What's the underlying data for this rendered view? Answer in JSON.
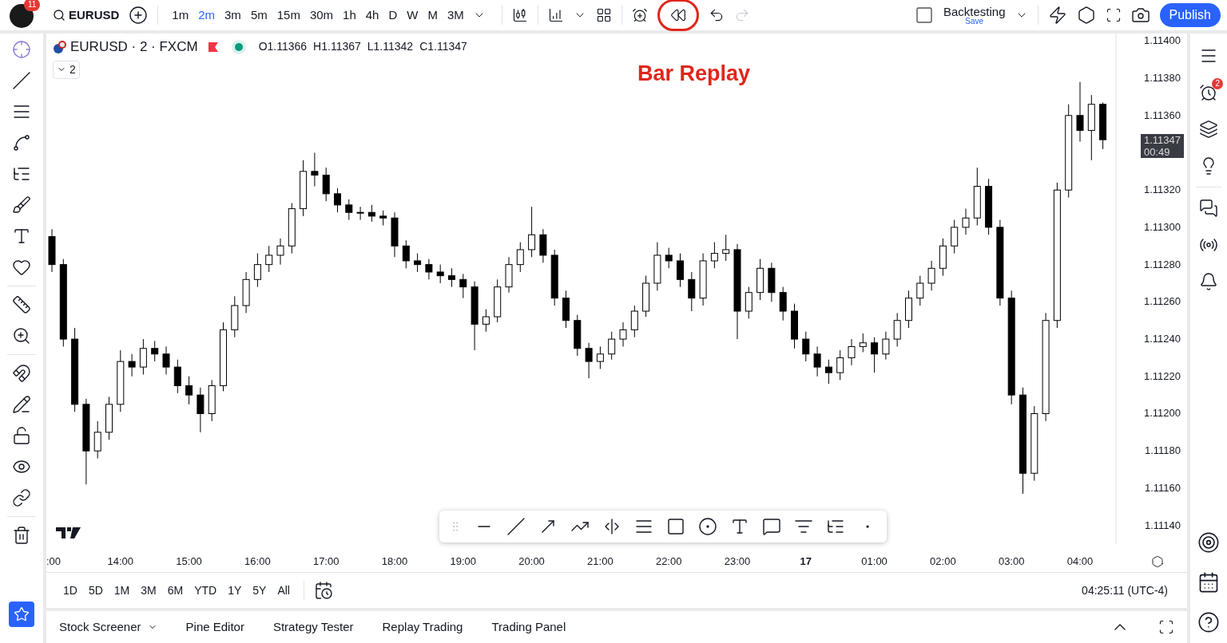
{
  "top_bar": {
    "avatar_badge": "11",
    "symbol": "EURUSD",
    "intervals": [
      {
        "label": "1m",
        "selected": false
      },
      {
        "label": "2m",
        "selected": true
      },
      {
        "label": "3m",
        "selected": false
      },
      {
        "label": "5m",
        "selected": false
      },
      {
        "label": "15m",
        "selected": false
      },
      {
        "label": "30m",
        "selected": false
      },
      {
        "label": "1h",
        "selected": false
      },
      {
        "label": "4h",
        "selected": false
      },
      {
        "label": "D",
        "selected": false
      },
      {
        "label": "W",
        "selected": false
      },
      {
        "label": "M",
        "selected": false
      },
      {
        "label": "3M",
        "selected": false
      }
    ],
    "replay_highlighted": true,
    "layout_name": "Backtesting",
    "layout_status": "Save",
    "publish": "Publish"
  },
  "annotation": "Bar Replay",
  "legend": {
    "title": "EURUSD · 2 · FXCM",
    "ohlc": [
      "O1.11366",
      "H1.11367",
      "L1.11342",
      "C1.11347"
    ],
    "indicators_count": "2"
  },
  "chart_data": {
    "type": "candlestick",
    "categories": [
      ":00",
      null,
      null,
      null,
      null,
      null,
      "14:00",
      null,
      null,
      null,
      null,
      null,
      "15:00",
      null,
      null,
      null,
      null,
      null,
      "16:00",
      null,
      null,
      null,
      null,
      null,
      "17:00",
      null,
      null,
      null,
      null,
      null,
      "18:00",
      null,
      null,
      null,
      null,
      null,
      "19:00",
      null,
      null,
      null,
      null,
      null,
      "20:00",
      null,
      null,
      null,
      null,
      null,
      "21:00",
      null,
      null,
      null,
      null,
      null,
      "22:00",
      null,
      null,
      null,
      null,
      null,
      "23:00",
      null,
      null,
      null,
      null,
      null,
      "**17**",
      null,
      null,
      null,
      null,
      null,
      "01:00",
      null,
      null,
      null,
      null,
      null,
      "02:00",
      null,
      null,
      null,
      null,
      null,
      "03:00",
      null,
      null,
      null,
      null,
      null,
      "04:00",
      null,
      null
    ],
    "ylim": [
      1.1113,
      1.11404
    ],
    "yticks": [
      {
        "value": 1.114,
        "label": "1.11400"
      },
      {
        "value": 1.1138,
        "label": "1.11380"
      },
      {
        "value": 1.1136,
        "label": "1.11360"
      },
      {
        "value": 1.1132,
        "label": "1.11320"
      },
      {
        "value": 1.113,
        "label": "1.11300"
      },
      {
        "value": 1.1128,
        "label": "1.11280"
      },
      {
        "value": 1.1126,
        "label": "1.11260"
      },
      {
        "value": 1.1124,
        "label": "1.11240"
      },
      {
        "value": 1.1122,
        "label": "1.11220"
      },
      {
        "value": 1.112,
        "label": "1.11200"
      },
      {
        "value": 1.1118,
        "label": "1.11180"
      },
      {
        "value": 1.1116,
        "label": "1.11160"
      },
      {
        "value": 1.1114,
        "label": "1.11140"
      }
    ],
    "ohlc": [
      [
        1.11295,
        1.11299,
        1.11276,
        1.1128
      ],
      [
        1.1128,
        1.11283,
        1.11236,
        1.1124
      ],
      [
        1.1124,
        1.11246,
        1.11201,
        1.11205
      ],
      [
        1.11205,
        1.11208,
        1.11162,
        1.1118
      ],
      [
        1.1118,
        1.11196,
        1.11176,
        1.1119
      ],
      [
        1.1119,
        1.11209,
        1.11186,
        1.11205
      ],
      [
        1.11205,
        1.11234,
        1.11201,
        1.11228
      ],
      [
        1.11228,
        1.11232,
        1.1122,
        1.11225
      ],
      [
        1.11225,
        1.1124,
        1.11221,
        1.11235
      ],
      [
        1.11235,
        1.11239,
        1.11228,
        1.11232
      ],
      [
        1.11232,
        1.11236,
        1.11221,
        1.11225
      ],
      [
        1.11225,
        1.11229,
        1.11211,
        1.11215
      ],
      [
        1.11215,
        1.1122,
        1.11205,
        1.1121
      ],
      [
        1.1121,
        1.11214,
        1.1119,
        1.112
      ],
      [
        1.112,
        1.11218,
        1.11196,
        1.11215
      ],
      [
        1.11215,
        1.11249,
        1.11212,
        1.11245
      ],
      [
        1.11245,
        1.11263,
        1.11241,
        1.11258
      ],
      [
        1.11258,
        1.11276,
        1.11254,
        1.11272
      ],
      [
        1.11272,
        1.11286,
        1.11268,
        1.1128
      ],
      [
        1.1128,
        1.1129,
        1.11276,
        1.11285
      ],
      [
        1.11285,
        1.11294,
        1.1128,
        1.1129
      ],
      [
        1.1129,
        1.11313,
        1.11286,
        1.1131
      ],
      [
        1.1131,
        1.11336,
        1.11306,
        1.1133
      ],
      [
        1.1133,
        1.1134,
        1.11322,
        1.11328
      ],
      [
        1.11328,
        1.11332,
        1.11314,
        1.11318
      ],
      [
        1.11318,
        1.11321,
        1.11308,
        1.11312
      ],
      [
        1.11312,
        1.11315,
        1.11304,
        1.11308
      ],
      [
        1.11308,
        1.11311,
        1.11304,
        1.11308
      ],
      [
        1.11308,
        1.11312,
        1.11303,
        1.11306
      ],
      [
        1.11306,
        1.11309,
        1.11301,
        1.11305
      ],
      [
        1.11305,
        1.11308,
        1.11284,
        1.1129
      ],
      [
        1.1129,
        1.11293,
        1.11278,
        1.11282
      ],
      [
        1.11282,
        1.11286,
        1.11276,
        1.1128
      ],
      [
        1.1128,
        1.11283,
        1.11272,
        1.11276
      ],
      [
        1.11276,
        1.1128,
        1.1127,
        1.11274
      ],
      [
        1.11274,
        1.11278,
        1.11268,
        1.11272
      ],
      [
        1.11272,
        1.11275,
        1.11262,
        1.11268
      ],
      [
        1.11268,
        1.11271,
        1.11234,
        1.11248
      ],
      [
        1.11248,
        1.11256,
        1.11244,
        1.11252
      ],
      [
        1.11252,
        1.11272,
        1.11249,
        1.11268
      ],
      [
        1.11268,
        1.11284,
        1.11265,
        1.1128
      ],
      [
        1.1128,
        1.11292,
        1.11276,
        1.11288
      ],
      [
        1.11288,
        1.11311,
        1.11284,
        1.11296
      ],
      [
        1.11296,
        1.11299,
        1.11281,
        1.11285
      ],
      [
        1.11285,
        1.11288,
        1.11258,
        1.11262
      ],
      [
        1.11262,
        1.11266,
        1.11246,
        1.1125
      ],
      [
        1.1125,
        1.11253,
        1.11231,
        1.11235
      ],
      [
        1.11235,
        1.11238,
        1.11219,
        1.11228
      ],
      [
        1.11228,
        1.11236,
        1.11224,
        1.11232
      ],
      [
        1.11232,
        1.11244,
        1.11229,
        1.1124
      ],
      [
        1.1124,
        1.11249,
        1.11236,
        1.11245
      ],
      [
        1.11245,
        1.11258,
        1.11241,
        1.11255
      ],
      [
        1.11255,
        1.11274,
        1.11252,
        1.1127
      ],
      [
        1.1127,
        1.11292,
        1.11266,
        1.11285
      ],
      [
        1.11285,
        1.11289,
        1.11278,
        1.11282
      ],
      [
        1.11282,
        1.11286,
        1.11268,
        1.11272
      ],
      [
        1.11272,
        1.11276,
        1.11255,
        1.11262
      ],
      [
        1.11262,
        1.11286,
        1.11258,
        1.11282
      ],
      [
        1.11282,
        1.11292,
        1.11278,
        1.11286
      ],
      [
        1.11286,
        1.11296,
        1.11282,
        1.11288
      ],
      [
        1.11288,
        1.11291,
        1.1124,
        1.11255
      ],
      [
        1.11255,
        1.11268,
        1.11251,
        1.11265
      ],
      [
        1.11265,
        1.11283,
        1.11261,
        1.11278
      ],
      [
        1.11278,
        1.11281,
        1.1126,
        1.11265
      ],
      [
        1.11265,
        1.11268,
        1.1125,
        1.11255
      ],
      [
        1.11255,
        1.11259,
        1.11235,
        1.1124
      ],
      [
        1.1124,
        1.11244,
        1.11228,
        1.11232
      ],
      [
        1.11232,
        1.11236,
        1.1122,
        1.11225
      ],
      [
        1.11225,
        1.11229,
        1.11216,
        1.11222
      ],
      [
        1.11222,
        1.11234,
        1.11218,
        1.1123
      ],
      [
        1.1123,
        1.1124,
        1.11226,
        1.11236
      ],
      [
        1.11236,
        1.11243,
        1.11233,
        1.11238
      ],
      [
        1.11238,
        1.11241,
        1.11222,
        1.11232
      ],
      [
        1.11232,
        1.11244,
        1.11229,
        1.1124
      ],
      [
        1.1124,
        1.11254,
        1.11236,
        1.1125
      ],
      [
        1.1125,
        1.11266,
        1.11246,
        1.11262
      ],
      [
        1.11262,
        1.11274,
        1.11258,
        1.1127
      ],
      [
        1.1127,
        1.11282,
        1.11266,
        1.11278
      ],
      [
        1.11278,
        1.11294,
        1.11274,
        1.1129
      ],
      [
        1.1129,
        1.11304,
        1.11286,
        1.113
      ],
      [
        1.113,
        1.1131,
        1.11296,
        1.11305
      ],
      [
        1.11305,
        1.11332,
        1.11301,
        1.11322
      ],
      [
        1.11322,
        1.11326,
        1.11296,
        1.113
      ],
      [
        1.113,
        1.11304,
        1.11258,
        1.11262
      ],
      [
        1.11262,
        1.11266,
        1.11205,
        1.1121
      ],
      [
        1.1121,
        1.11214,
        1.11157,
        1.11168
      ],
      [
        1.11168,
        1.11204,
        1.11164,
        1.112
      ],
      [
        1.112,
        1.11254,
        1.11196,
        1.1125
      ],
      [
        1.1125,
        1.11324,
        1.11246,
        1.1132
      ],
      [
        1.1132,
        1.11366,
        1.11316,
        1.1136
      ],
      [
        1.1136,
        1.11378,
        1.11346,
        1.11352
      ],
      [
        1.11352,
        1.11371,
        1.11336,
        1.11366
      ],
      [
        1.11366,
        1.11367,
        1.11342,
        1.11347
      ]
    ]
  },
  "last_price": {
    "price": "1.11347",
    "countdown": "00:49"
  },
  "ranges": [
    "1D",
    "5D",
    "1M",
    "3M",
    "6M",
    "YTD",
    "1Y",
    "5Y",
    "All"
  ],
  "clock": "04:25:11 (UTC-4)",
  "right_sidebar": {
    "alerts_badge": "2"
  },
  "bottom_tabs": [
    {
      "label": "Stock Screener",
      "has_menu": true
    },
    {
      "label": "Pine Editor",
      "has_menu": false
    },
    {
      "label": "Strategy Tester",
      "has_menu": false
    },
    {
      "label": "Replay Trading",
      "has_menu": false
    },
    {
      "label": "Trading Panel",
      "has_menu": false
    }
  ]
}
